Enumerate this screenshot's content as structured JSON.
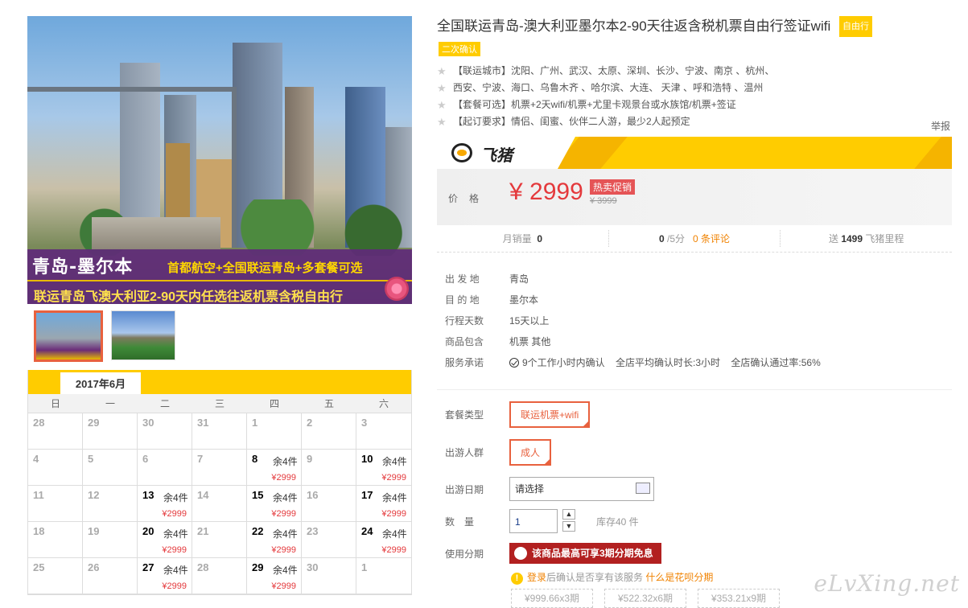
{
  "banner": {
    "title": "青岛-墨尔本",
    "subtitle": "首都航空+全国联运青岛+多套餐可选",
    "line": "联运青岛飞澳大利亚2-90天内任选往返机票含税自由行"
  },
  "calendar": {
    "month": "2017年6月",
    "weekdays": [
      "日",
      "一",
      "二",
      "三",
      "四",
      "五",
      "六"
    ],
    "cells": [
      {
        "day": "28"
      },
      {
        "day": "29"
      },
      {
        "day": "30"
      },
      {
        "day": "31"
      },
      {
        "day": "1"
      },
      {
        "day": "2"
      },
      {
        "day": "3"
      },
      {
        "day": "4"
      },
      {
        "day": "5"
      },
      {
        "day": "6"
      },
      {
        "day": "7"
      },
      {
        "day": "8",
        "stock": "余4件",
        "price": "¥2999"
      },
      {
        "day": "9"
      },
      {
        "day": "10",
        "stock": "余4件",
        "price": "¥2999"
      },
      {
        "day": "11"
      },
      {
        "day": "12"
      },
      {
        "day": "13",
        "stock": "余4件",
        "price": "¥2999"
      },
      {
        "day": "14"
      },
      {
        "day": "15",
        "stock": "余4件",
        "price": "¥2999"
      },
      {
        "day": "16"
      },
      {
        "day": "17",
        "stock": "余4件",
        "price": "¥2999"
      },
      {
        "day": "18"
      },
      {
        "day": "19"
      },
      {
        "day": "20",
        "stock": "余4件",
        "price": "¥2999"
      },
      {
        "day": "21"
      },
      {
        "day": "22",
        "stock": "余4件",
        "price": "¥2999"
      },
      {
        "day": "23"
      },
      {
        "day": "24",
        "stock": "余4件",
        "price": "¥2999"
      },
      {
        "day": "25"
      },
      {
        "day": "26"
      },
      {
        "day": "27",
        "stock": "余4件",
        "price": "¥2999"
      },
      {
        "day": "28"
      },
      {
        "day": "29",
        "stock": "余4件",
        "price": "¥2999"
      },
      {
        "day": "30"
      },
      {
        "day": "1"
      }
    ]
  },
  "product": {
    "title": "全国联运青岛-澳大利亚墨尔本2-90天往返含税机票自由行签证wifi",
    "tag1": "自由行",
    "tag2": "二次确认",
    "features": [
      "【联运城市】沈阳、广州、武汉、太原、深圳、长沙、宁波、南京 、杭州、",
      "西安、宁波、海口、乌鲁木齐 、哈尔滨、大连、 天津 、呼和浩特 、温州",
      "【套餐可选】机票+2天wifi/机票+尤里卡观景台或水族馆/机票+签证",
      "【起订要求】情侣、闺蜜、伙伴二人游，最少2人起预定"
    ],
    "report": "举报"
  },
  "brand": {
    "name": "飞猪"
  },
  "price": {
    "label": "价格",
    "current": "¥ 2999",
    "hot_tag": "热卖促销",
    "original": "¥ 3999"
  },
  "stats": {
    "sales_label": "月销量",
    "sales_value": "0",
    "rating_value": "0",
    "rating_suffix": "/5分",
    "reviews_link": "0 条评论",
    "gift_prefix": "送",
    "gift_value": "1499",
    "gift_suffix": "飞猪里程"
  },
  "info": {
    "rows": [
      {
        "label": "出 发 地",
        "value": "青岛"
      },
      {
        "label": "目 的 地",
        "value": "墨尔本"
      },
      {
        "label": "行程天数",
        "value": "15天以上"
      },
      {
        "label": "商品包含",
        "value": "机票  其他"
      }
    ],
    "service_label": "服务承诺",
    "service_items": [
      "9个工作小时内确认",
      "全店平均确认时长:3小时",
      "全店确认通过率:56%"
    ]
  },
  "options": {
    "package_label": "套餐类型",
    "package_value": "联运机票+wifi",
    "people_label": "出游人群",
    "people_value": "成人",
    "date_label": "出游日期",
    "date_placeholder": "请选择",
    "qty_label": "数　量",
    "qty_value": "1",
    "stock_text": "库存40 件",
    "install_label": "使用分期",
    "install_button": "该商品最高可享3期分期免息",
    "install_tip_link": "登录",
    "install_tip_text": "后确认是否享有该服务",
    "install_tip_more": "什么是花呗分期",
    "plans": [
      "¥999.66x3期",
      "¥522.32x6期",
      "¥353.21x9期"
    ]
  },
  "watermark": "eLvXing.net"
}
